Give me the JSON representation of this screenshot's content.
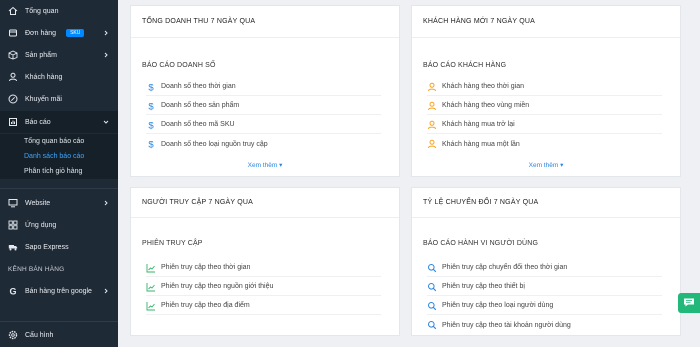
{
  "sidebar": {
    "items": [
      {
        "label": "Tổng quan"
      },
      {
        "label": "Đơn hàng",
        "badge": "SKU"
      },
      {
        "label": "Sản phẩm"
      },
      {
        "label": "Khách hàng"
      },
      {
        "label": "Khuyến mãi"
      },
      {
        "label": "Báo cáo"
      }
    ],
    "report_sub": [
      {
        "label": "Tổng quan báo cáo"
      },
      {
        "label": "Danh sách báo cáo"
      },
      {
        "label": "Phân tích giỏ hàng"
      }
    ],
    "items2": [
      {
        "label": "Website"
      },
      {
        "label": "Ứng dụng"
      },
      {
        "label": "Sapo Express"
      }
    ],
    "channel_header": "KÊNH BÁN HÀNG",
    "google_item": "Bán hàng trên google",
    "settings": "Cấu hình"
  },
  "cards": {
    "revenue": {
      "header": "TỔNG DOANH THU 7 NGÀY QUA",
      "section": "BÁO CÁO DOANH SỐ",
      "rows": [
        "Doanh số theo thời gian",
        "Doanh số theo sản phẩm",
        "Doanh số theo mã SKU",
        "Doanh số theo loại nguồn truy cập"
      ]
    },
    "customers": {
      "header": "KHÁCH HÀNG MỚI 7 NGÀY QUA",
      "section": "BÁO CÁO KHÁCH HÀNG",
      "rows": [
        "Khách hàng theo thời gian",
        "Khách hàng theo vùng miền",
        "Khách hàng mua trở lại",
        "Khách hàng mua một lần"
      ],
      "see_more": "Xem thêm ▾"
    },
    "visitors": {
      "header": "NGƯỜI TRUY CẬP 7 NGÀY QUA",
      "section": "PHIÊN TRUY CẬP",
      "rows": [
        "Phiên truy cập theo thời gian",
        "Phiên truy cập theo nguồn giới thiệu",
        "Phiên truy cập theo địa điểm"
      ]
    },
    "conversion": {
      "header": "TỶ LỆ CHUYỂN ĐỔI 7 NGÀY QUA",
      "section": "BÁO CÁO HÀNH VI NGƯỜI DÙNG",
      "rows": [
        "Phiên truy cập chuyển đổi theo thời gian",
        "Phiên truy cập theo thiết bị",
        "Phiên truy cập theo loại người dùng",
        "Phiên truy cập theo tài khoản người dùng"
      ]
    },
    "revenue_see_more": "Xem thêm ▾"
  },
  "colors": {
    "sidebar": "#1f2a37",
    "accent": "#2b86e0",
    "active_link": "#3aa6ff",
    "chat": "#21b87a"
  }
}
